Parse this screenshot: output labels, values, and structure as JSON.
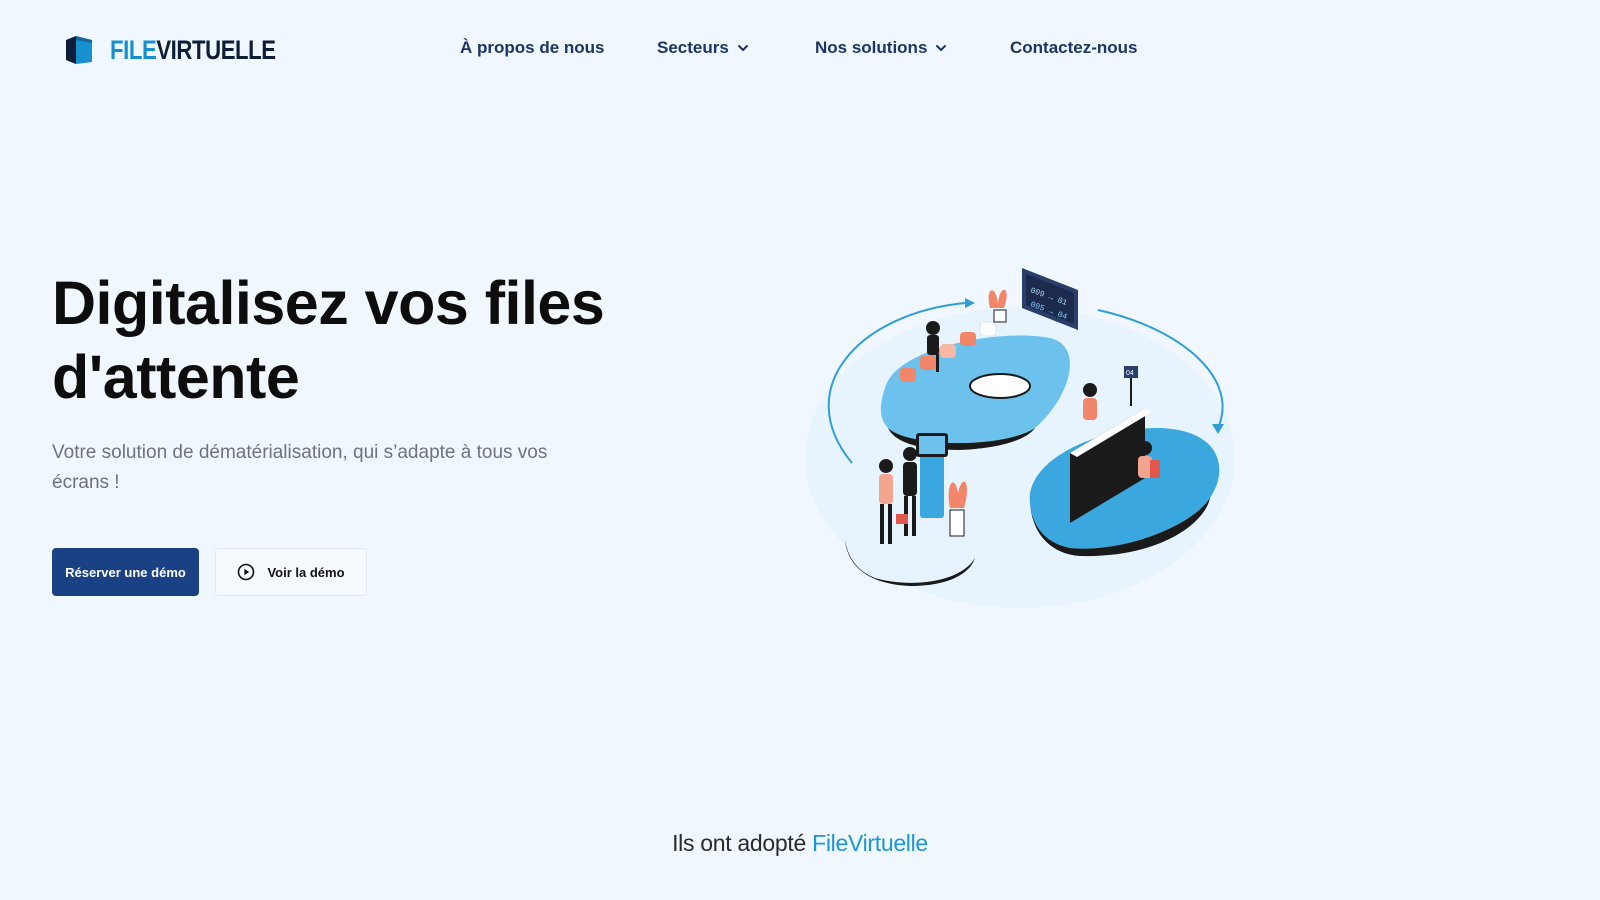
{
  "header": {
    "logo": {
      "part1": "FILE",
      "part2": "VIRTUELLE"
    },
    "nav": [
      {
        "label": "À propos de nous",
        "has_dropdown": false
      },
      {
        "label": "Secteurs",
        "has_dropdown": true
      },
      {
        "label": "Nos solutions",
        "has_dropdown": true
      },
      {
        "label": "Contactez-nous",
        "has_dropdown": false
      }
    ]
  },
  "hero": {
    "title": "Digitalisez vos files d'attente",
    "subtitle": "Votre solution de dématérialisation, qui s’adapte à tous vos écrans !",
    "primary_button": "Réserver une démo",
    "secondary_button": "Voir la démo",
    "board_lines": [
      "009 → 01",
      "005 → 04"
    ],
    "counter_number": "04"
  },
  "adopt": {
    "prefix": "Ils ont adopté ",
    "brand": "FileVirtuelle"
  },
  "colors": {
    "background": "#f0f7fe",
    "nav_text": "#1a3566",
    "primary_button": "#1b4185",
    "brand_blue": "#1a97d4",
    "illustration_blue": "#62bde9",
    "accent_salmon": "#f2866b"
  },
  "icons": [
    "logo-mark-icon",
    "chevron-down-icon",
    "play-circle-icon"
  ]
}
